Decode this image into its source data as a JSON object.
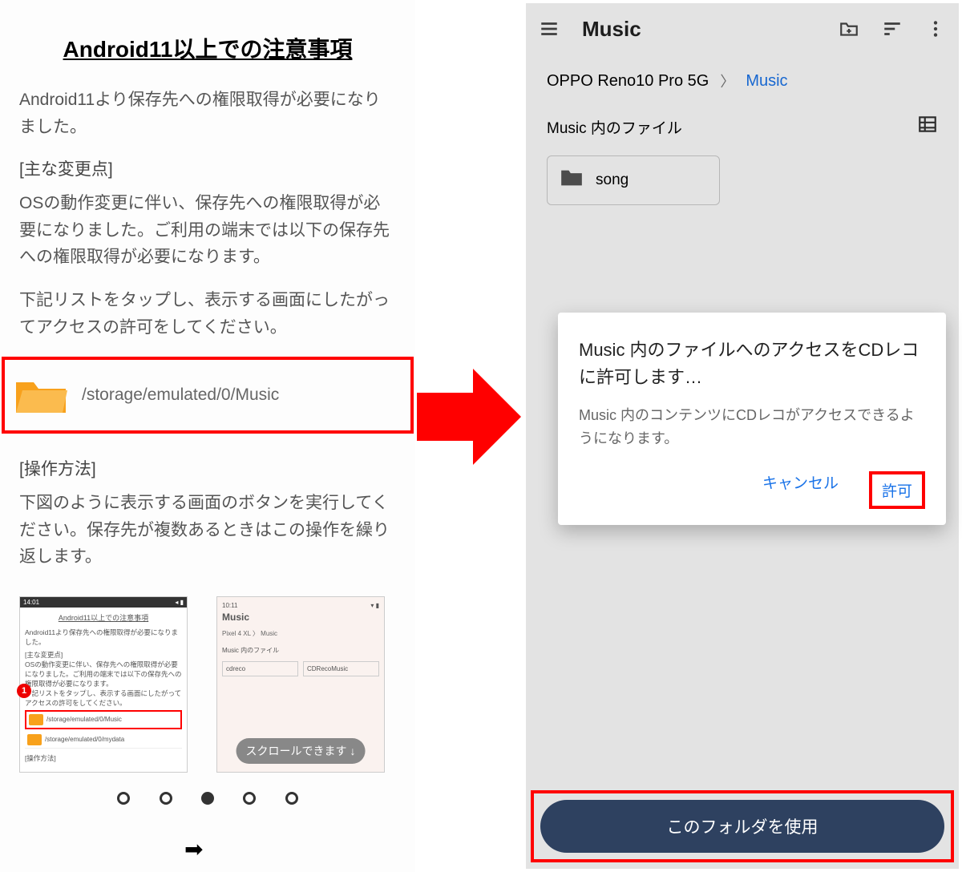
{
  "left": {
    "title": "Android11以上での注意事項",
    "intro": "Android11より保存先への権限取得が必要になりました。",
    "changes_heading": "[主な変更点]",
    "changes_p1": "OSの動作変更に伴い、保存先への権限取得が必要になりました。ご利用の端末では以下の保存先への権限取得が必要になります。",
    "changes_p2": "下記リストをタップし、表示する画面にしたがってアクセスの許可をしてください。",
    "path": "/storage/emulated/0/Music",
    "howto_heading": "[操作方法]",
    "howto_body": "下図のように表示する画面のボタンを実行してください。保存先が複数あるときはこの操作を繰り返します。",
    "thumb1": {
      "time": "14:01",
      "title": "Android11以上での注意事項",
      "line1": "Android11より保存先への権限取得が必要になりました。",
      "h": "[主な変更点]",
      "body": "OSの動作変更に伴い、保存先への権限取得が必要になりました。ご利用の端末では以下の保存先への権限取得が必要になります。",
      "body2": "下記リストをタップし、表示する画面にしたがってアクセスの許可をしてください。",
      "path1": "/storage/emulated/0/Music",
      "path2": "/storage/emulated/0/mydata",
      "howto": "[操作方法]",
      "badge": "1"
    },
    "thumb2": {
      "time": "10:11",
      "title": "Music",
      "bc": "Pixel 4 XL   〉   Music",
      "lbl": "Music 内のファイル",
      "f1": "cdreco",
      "f2": "CDRecoMusic",
      "scroll": "スクロールできます ↓"
    },
    "dots_active": 2,
    "dots_total": 5
  },
  "right": {
    "appbar_title": "Music",
    "breadcrumb_root": "OPPO Reno10 Pro 5G",
    "breadcrumb_current": "Music",
    "section_title": "Music 内のファイル",
    "folder_name": "song",
    "dialog_title": "Music 内のファイルへのアクセスをCDレコに許可します…",
    "dialog_body": "Music 内のコンテンツにCDレコがアクセスできるようになります。",
    "cancel": "キャンセル",
    "allow": "許可",
    "use_folder": "このフォルダを使用"
  }
}
